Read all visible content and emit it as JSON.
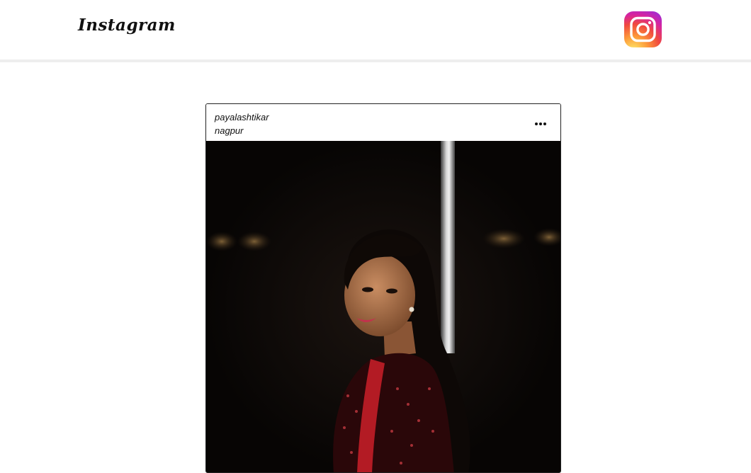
{
  "header": {
    "brand": "Instagram",
    "logo_icon": "instagram-logo-icon"
  },
  "post": {
    "username": "payalashtikar",
    "location": "nagpur",
    "more_icon": "more-options-icon",
    "photo": {
      "subject": "portrait-photo"
    }
  },
  "colors": {
    "topbar_border": "#eeeeee",
    "text": "#111111",
    "photo_background": "#070504"
  }
}
